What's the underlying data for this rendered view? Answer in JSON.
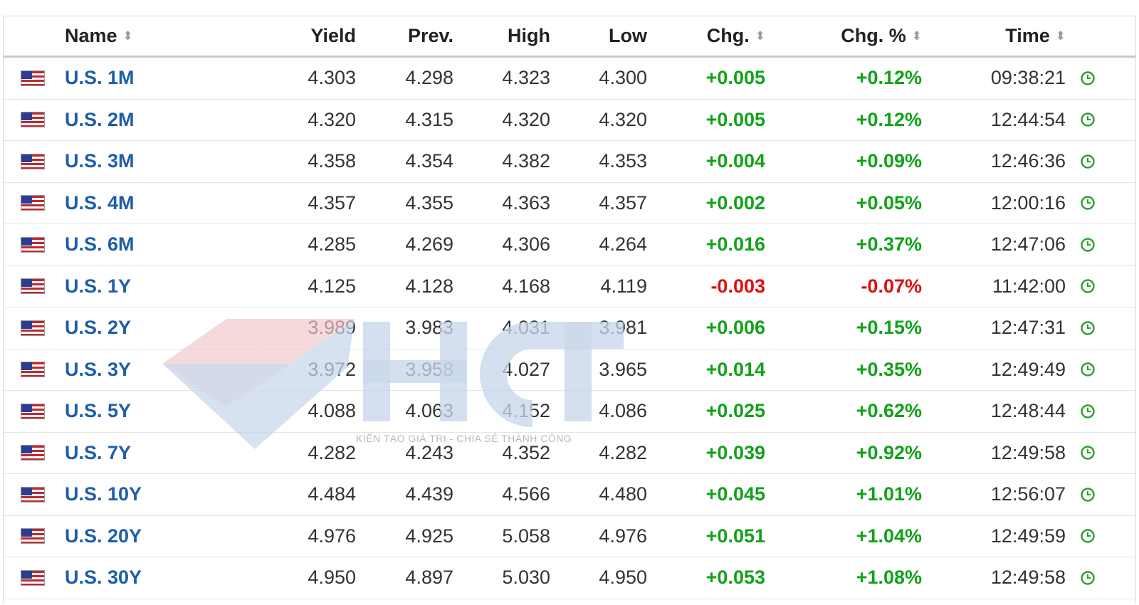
{
  "header": {
    "name": "Name",
    "yield": "Yield",
    "prev": "Prev.",
    "high": "High",
    "low": "Low",
    "chg": "Chg.",
    "chg_pct": "Chg. %",
    "time": "Time"
  },
  "rows": [
    {
      "name": "U.S. 1M",
      "yield": "4.303",
      "prev": "4.298",
      "high": "4.323",
      "low": "4.300",
      "chg": "+0.005",
      "chg_pct": "+0.12%",
      "time": "09:38:21"
    },
    {
      "name": "U.S. 2M",
      "yield": "4.320",
      "prev": "4.315",
      "high": "4.320",
      "low": "4.320",
      "chg": "+0.005",
      "chg_pct": "+0.12%",
      "time": "12:44:54"
    },
    {
      "name": "U.S. 3M",
      "yield": "4.358",
      "prev": "4.354",
      "high": "4.382",
      "low": "4.353",
      "chg": "+0.004",
      "chg_pct": "+0.09%",
      "time": "12:46:36"
    },
    {
      "name": "U.S. 4M",
      "yield": "4.357",
      "prev": "4.355",
      "high": "4.363",
      "low": "4.357",
      "chg": "+0.002",
      "chg_pct": "+0.05%",
      "time": "12:00:16"
    },
    {
      "name": "U.S. 6M",
      "yield": "4.285",
      "prev": "4.269",
      "high": "4.306",
      "low": "4.264",
      "chg": "+0.016",
      "chg_pct": "+0.37%",
      "time": "12:47:06"
    },
    {
      "name": "U.S. 1Y",
      "yield": "4.125",
      "prev": "4.128",
      "high": "4.168",
      "low": "4.119",
      "chg": "-0.003",
      "chg_pct": "-0.07%",
      "time": "11:42:00"
    },
    {
      "name": "U.S. 2Y",
      "yield": "3.989",
      "prev": "3.983",
      "high": "4.031",
      "low": "3.981",
      "chg": "+0.006",
      "chg_pct": "+0.15%",
      "time": "12:47:31"
    },
    {
      "name": "U.S. 3Y",
      "yield": "3.972",
      "prev": "3.958",
      "high": "4.027",
      "low": "3.965",
      "chg": "+0.014",
      "chg_pct": "+0.35%",
      "time": "12:49:49"
    },
    {
      "name": "U.S. 5Y",
      "yield": "4.088",
      "prev": "4.063",
      "high": "4.152",
      "low": "4.086",
      "chg": "+0.025",
      "chg_pct": "+0.62%",
      "time": "12:48:44"
    },
    {
      "name": "U.S. 7Y",
      "yield": "4.282",
      "prev": "4.243",
      "high": "4.352",
      "low": "4.282",
      "chg": "+0.039",
      "chg_pct": "+0.92%",
      "time": "12:49:58"
    },
    {
      "name": "U.S. 10Y",
      "yield": "4.484",
      "prev": "4.439",
      "high": "4.566",
      "low": "4.480",
      "chg": "+0.045",
      "chg_pct": "+1.01%",
      "time": "12:56:07"
    },
    {
      "name": "U.S. 20Y",
      "yield": "4.976",
      "prev": "4.925",
      "high": "5.058",
      "low": "4.976",
      "chg": "+0.051",
      "chg_pct": "+1.04%",
      "time": "12:49:59"
    },
    {
      "name": "U.S. 30Y",
      "yield": "4.950",
      "prev": "4.897",
      "high": "5.030",
      "low": "4.950",
      "chg": "+0.053",
      "chg_pct": "+1.08%",
      "time": "12:49:58"
    }
  ],
  "icons": {
    "flag": "us-flag-icon",
    "time": "clock-icon",
    "sort": "sort-icon"
  },
  "colors": {
    "name_link": "#1d5ea8",
    "positive": "#11a21a",
    "negative": "#e00e0e",
    "clock": "#2e9e2e"
  },
  "watermark": {
    "logo_text": "HCT",
    "tagline": "KIẾN TẠO GIÁ TRỊ - CHIA SẺ THÀNH CÔNG"
  }
}
